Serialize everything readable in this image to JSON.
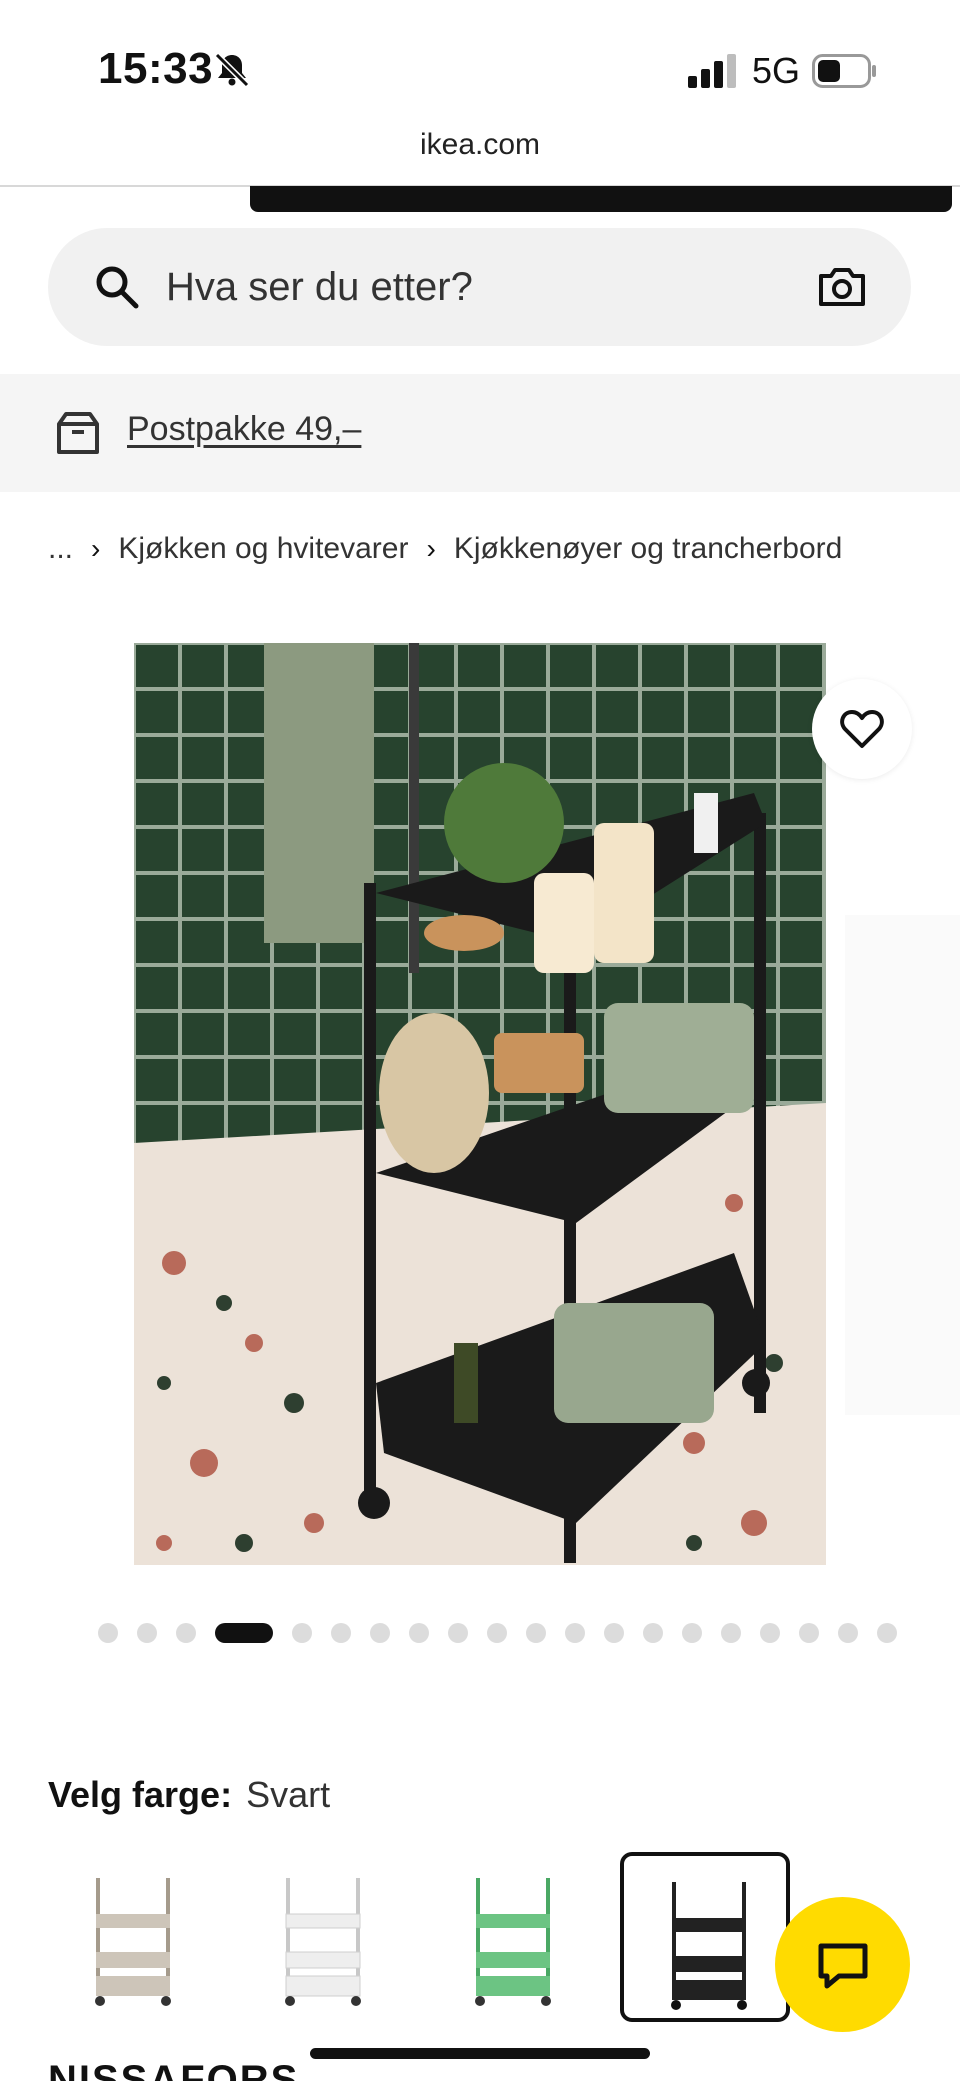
{
  "status_bar": {
    "time": "15:33",
    "network": "5G",
    "icons": [
      "bell-slash-icon",
      "signal-icon",
      "battery-icon"
    ]
  },
  "browser": {
    "url": "ikea.com"
  },
  "search": {
    "placeholder": "Hva ser du etter?",
    "icons": [
      "search-icon",
      "camera-icon"
    ]
  },
  "postpakke": {
    "label": "Postpakke 49,–",
    "icon": "box-icon"
  },
  "breadcrumb": {
    "ellipsis": "...",
    "separator": "›",
    "items": [
      "Kjøkken og hvitevarer",
      "Kjøkkenøyer og trancherbord"
    ]
  },
  "product": {
    "name": "NISSAFORS",
    "image_icon": "heart-icon"
  },
  "carousel": {
    "total_images": 20,
    "active_index": 3
  },
  "color_select": {
    "label": "Velg farge:",
    "selected": "Svart",
    "swatches": [
      {
        "color": "#cdc5b9",
        "selected": false
      },
      {
        "color": "#eeeeee",
        "selected": false
      },
      {
        "color": "#6cc483",
        "selected": false
      },
      {
        "color": "#222222",
        "selected": true
      }
    ]
  },
  "chat": {
    "icon": "chat-icon",
    "color": "#ffdb00"
  }
}
